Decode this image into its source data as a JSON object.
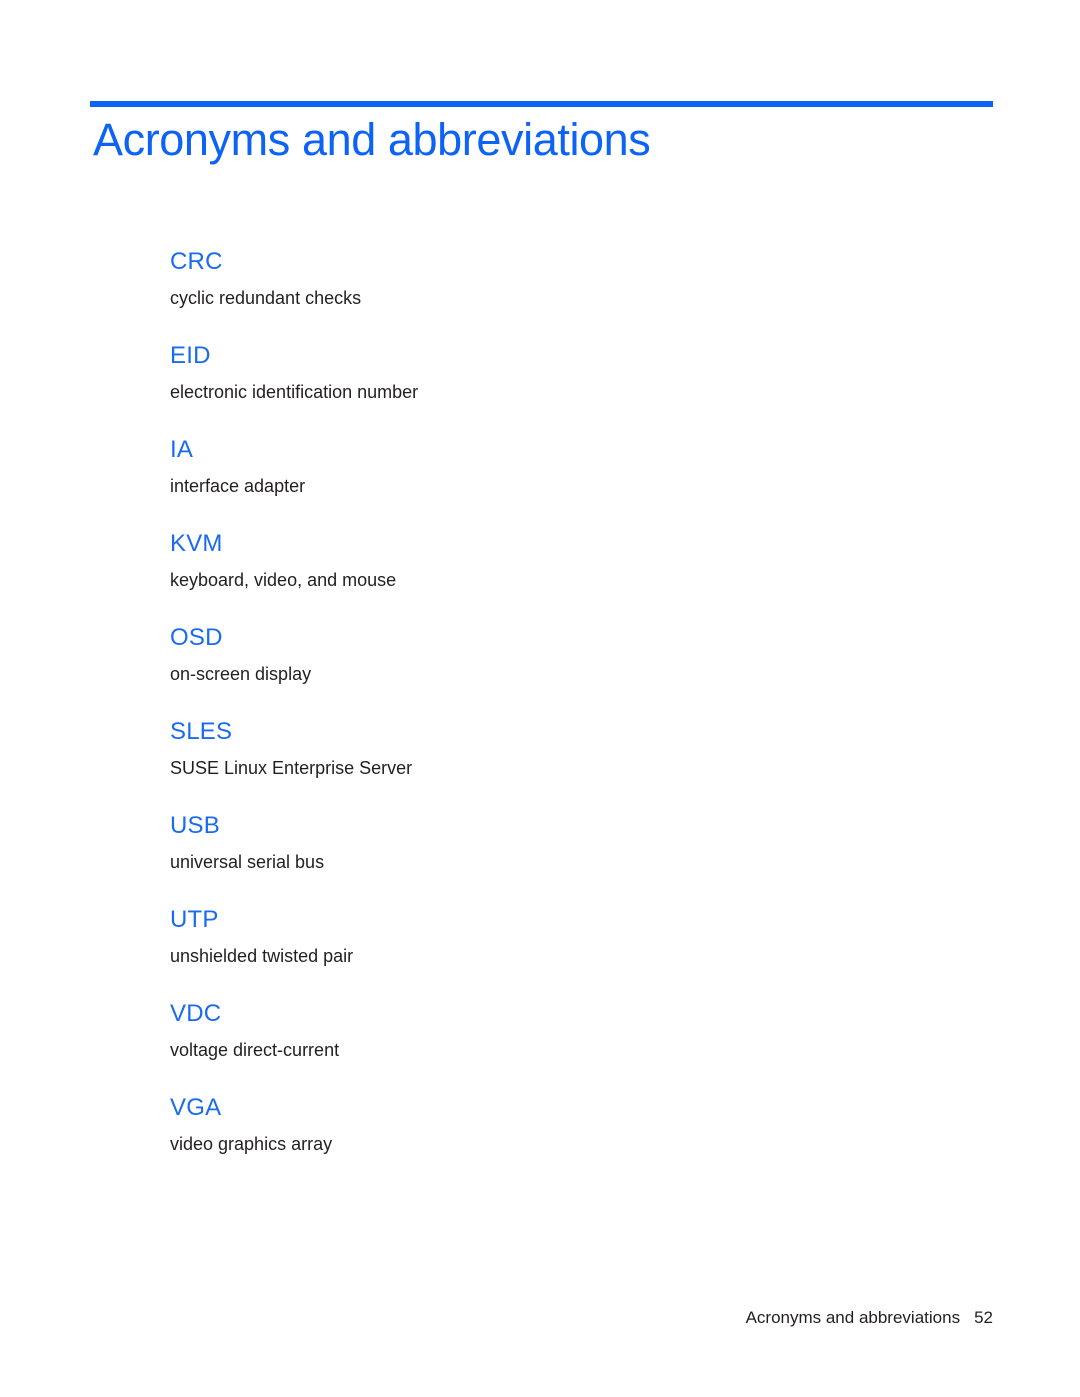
{
  "document": {
    "title": "Acronyms and abbreviations",
    "accent_color": "#0d63f5",
    "term_color": "#1a6bf0",
    "body_text_color": "#231f20"
  },
  "glossary": {
    "entries": [
      {
        "term": "CRC",
        "definition": "cyclic redundant checks"
      },
      {
        "term": "EID",
        "definition": "electronic identification number"
      },
      {
        "term": "IA",
        "definition": "interface adapter"
      },
      {
        "term": "KVM",
        "definition": "keyboard, video, and mouse"
      },
      {
        "term": "OSD",
        "definition": "on-screen display"
      },
      {
        "term": "SLES",
        "definition": "SUSE Linux Enterprise Server"
      },
      {
        "term": "USB",
        "definition": "universal serial bus"
      },
      {
        "term": "UTP",
        "definition": "unshielded twisted pair"
      },
      {
        "term": "VDC",
        "definition": "voltage direct-current"
      },
      {
        "term": "VGA",
        "definition": "video graphics array"
      }
    ]
  },
  "footer": {
    "label": "Acronyms and abbreviations",
    "page_number": "52"
  }
}
